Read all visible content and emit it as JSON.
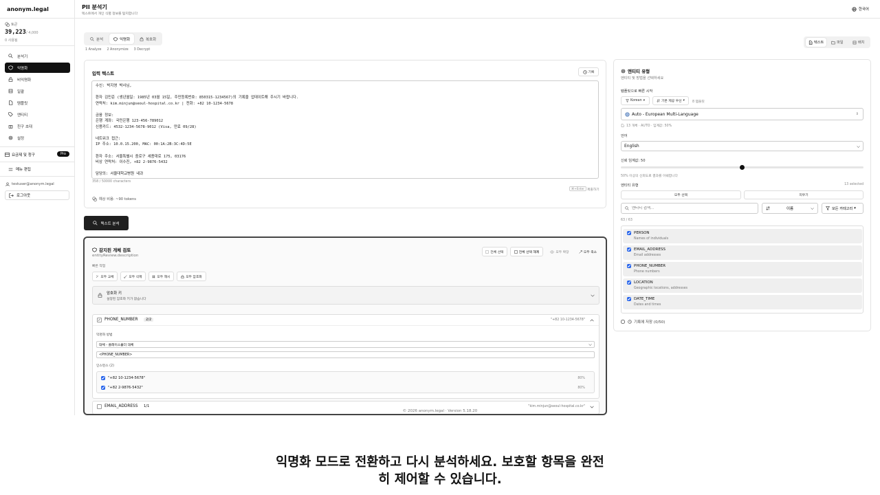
{
  "sidebar": {
    "brand": "anonym.legal",
    "tokens_label": "토큰",
    "tokens_value": "39,223",
    "tokens_total": "/ 4,000",
    "tokens_used": "0 사용됨",
    "nav": [
      {
        "label": "분석기",
        "icon": "search-icon"
      },
      {
        "label": "익명화",
        "icon": "shield-icon"
      },
      {
        "label": "비익명화",
        "icon": "unlock-icon"
      },
      {
        "label": "일괄",
        "icon": "stack-icon"
      },
      {
        "label": "템플릿",
        "icon": "file-icon"
      },
      {
        "label": "엔티티",
        "icon": "tag-icon"
      },
      {
        "label": "친구 초대",
        "icon": "gift-icon"
      },
      {
        "label": "설정",
        "icon": "gear-icon"
      }
    ],
    "billing": "요금제 및 청구",
    "pro_badge": "Pro",
    "menu_edit": "메뉴 편집",
    "user_email": "testuser@anonym.legal",
    "logout": "로그아웃"
  },
  "header": {
    "title": "PII 분석기",
    "subtitle": "텍스트에서 개인 식별 정보를 탐지합니다",
    "language": "한국어"
  },
  "mode_tabs": [
    "분석",
    "익명화",
    "복호화"
  ],
  "steps": [
    "1 Analyze",
    "2 Anonymize",
    "3 Decrypt"
  ],
  "io_tabs": [
    "텍스트",
    "파일",
    "배치"
  ],
  "input": {
    "title": "입력 텍스트",
    "history_button": "기록",
    "text": "수신: 박지영 박사님,\n\n환자 김민준 (생년월일: 1985년 03월 15일, 주민등록번호: 850315-1234567)의 기록을 업데이트해 주시기 바랍니다.\n연락처: kim.minjun@seoul-hospital.co.kr | 전화: +82 10-1234-5678\n\n금융 정보:\n은행 계좌: 국민은행 123-456-789012\n신용카드: 4532-1234-5678-9012 (Visa, 만료 09/28)\n\n네트워크 접근:\nIP 주소: 10.0.15.200, MAC: 00:1A:2B:3C:4D:5E\n\n환자 주소: 서울특별시 중로구 세종대로 175, 03176\n비상 연락처: 이수진, +82 2-9876-5432\n\n담당의: 서울대학교병원 내과",
    "char_count": "358 / 50000 characters",
    "shortcut_key": "⌘+Enter",
    "shortcut_label": "제출하기",
    "cost": "예상 비용: ~90 tokens",
    "analyze_button": "텍스트 분석"
  },
  "review": {
    "title": "감지된 개체 검토",
    "description": "entityReview.description",
    "buttons": [
      "전체 선택",
      "전체 선택 해제",
      "모두 확장",
      "모두 축소"
    ],
    "quick_actions_label": "빠른 작업",
    "quick_actions": [
      "모두 교체",
      "모두 삭제",
      "모두 해시",
      "모두 암호화"
    ],
    "encryption_title": "암호화 키",
    "encryption_sub": "설정된 암호화 키가 없습니다",
    "entity_name": "PHONE_NUMBER",
    "entity_count": "2/2",
    "entity_preview": "\"+82 10-1234-5678\"",
    "method_label": "익명화 방법",
    "method_value": "대체 - 플레이스홀더 대체",
    "replacement_value": "<PHONE_NUMBER>",
    "instances_label": "인스턴스 (2)",
    "instances": [
      {
        "text": "\"+82 10-1234-5678\"",
        "score": "80%"
      },
      {
        "text": "\"+82 2-9876-5432\"",
        "score": "80%"
      }
    ],
    "next_entity": "EMAIL_ADDRESS",
    "next_count": "1/1",
    "next_preview": "\"kim.minjun@seoul-hospital.co.kr\""
  },
  "entity_panel": {
    "title": "엔티티 유형",
    "subtitle": "엔티티 및 방법을 선택하세요",
    "quick_start_label": "템플릿으로 빠른 시작",
    "korean_filter": "Korean",
    "default_filter": "기본 제공 우선",
    "template_count": "8 템플릿",
    "preset_value": "Auto - European Multi-Language",
    "preset_meta": "13 개체 · AUTO · 임계값: 50%",
    "language_label": "언어",
    "language_value": "English",
    "threshold_label": "신뢰 임계값: 50",
    "threshold_value": 0.5,
    "threshold_help": "50% 이상의 신뢰도로 결과를 이쉐합니다",
    "types_label": "엔티티 유형",
    "selected_count": "13 selected",
    "select_all": "모두 선택",
    "clear": "지우기",
    "search_placeholder": "엔티티 검색...",
    "sort_value": "이름",
    "category_value": "모든 카테고리",
    "shown_count": "63 / 63",
    "entities": [
      {
        "name": "PERSON",
        "desc": "Names of individuals"
      },
      {
        "name": "EMAIL_ADDRESS",
        "desc": "Email addresses"
      },
      {
        "name": "PHONE_NUMBER",
        "desc": "Phone numbers"
      },
      {
        "name": "LOCATION",
        "desc": "Geographic locations, addresses"
      },
      {
        "name": "DATE_TIME",
        "desc": "Dates and times"
      }
    ],
    "save_history": "기록에 저장 (0/50)"
  },
  "footer": "© 2026 anonym.legal · Version 5.18.20",
  "caption": "익명화 모드로 전환하고 다시 분석하세요. 보호할 항목을 완전히 제어할 수 있습니다.",
  "colors": {
    "accent": "#111111",
    "checkbox": "#2563eb"
  }
}
